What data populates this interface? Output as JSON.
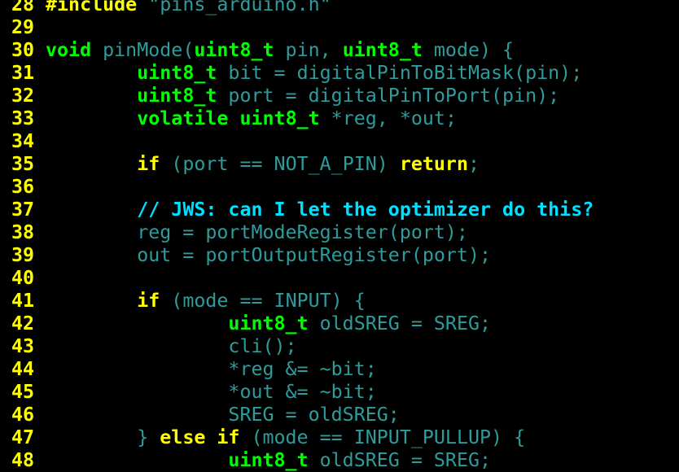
{
  "colors": {
    "background": "#000000",
    "line_number": "#ffff00",
    "type_keyword": "#00ff00",
    "control_keyword": "#ffff00",
    "comment": "#00e0ff",
    "plain_code": "#2e9c9c"
  },
  "lines": [
    {
      "number": "28",
      "tokens": [
        {
          "cls": "kw",
          "text": "#include"
        },
        {
          "cls": "ident",
          "text": " \"pins_arduino.h\""
        }
      ]
    },
    {
      "number": "29",
      "tokens": []
    },
    {
      "number": "30",
      "tokens": [
        {
          "cls": "type",
          "text": "void"
        },
        {
          "cls": "ident",
          "text": " pinMode("
        },
        {
          "cls": "type",
          "text": "uint8_t"
        },
        {
          "cls": "ident",
          "text": " pin, "
        },
        {
          "cls": "type",
          "text": "uint8_t"
        },
        {
          "cls": "ident",
          "text": " mode) {"
        }
      ]
    },
    {
      "number": "31",
      "tokens": [
        {
          "cls": "ident",
          "text": "        "
        },
        {
          "cls": "type",
          "text": "uint8_t"
        },
        {
          "cls": "ident",
          "text": " bit = digitalPinToBitMask(pin);"
        }
      ]
    },
    {
      "number": "32",
      "tokens": [
        {
          "cls": "ident",
          "text": "        "
        },
        {
          "cls": "type",
          "text": "uint8_t"
        },
        {
          "cls": "ident",
          "text": " port = digitalPinToPort(pin);"
        }
      ]
    },
    {
      "number": "33",
      "tokens": [
        {
          "cls": "ident",
          "text": "        "
        },
        {
          "cls": "type",
          "text": "volatile"
        },
        {
          "cls": "ident",
          "text": " "
        },
        {
          "cls": "type",
          "text": "uint8_t"
        },
        {
          "cls": "ident",
          "text": " *reg, *out;"
        }
      ]
    },
    {
      "number": "34",
      "tokens": []
    },
    {
      "number": "35",
      "tokens": [
        {
          "cls": "ident",
          "text": "        "
        },
        {
          "cls": "kw",
          "text": "if"
        },
        {
          "cls": "ident",
          "text": " (port == NOT_A_PIN) "
        },
        {
          "cls": "kw",
          "text": "return"
        },
        {
          "cls": "ident",
          "text": ";"
        }
      ]
    },
    {
      "number": "36",
      "tokens": []
    },
    {
      "number": "37",
      "tokens": [
        {
          "cls": "ident",
          "text": "        "
        },
        {
          "cls": "comment",
          "text": "// JWS: can I let the optimizer do this?"
        }
      ]
    },
    {
      "number": "38",
      "tokens": [
        {
          "cls": "ident",
          "text": "        reg = portModeRegister(port);"
        }
      ]
    },
    {
      "number": "39",
      "tokens": [
        {
          "cls": "ident",
          "text": "        out = portOutputRegister(port);"
        }
      ]
    },
    {
      "number": "40",
      "tokens": []
    },
    {
      "number": "41",
      "tokens": [
        {
          "cls": "ident",
          "text": "        "
        },
        {
          "cls": "kw",
          "text": "if"
        },
        {
          "cls": "ident",
          "text": " (mode == INPUT) {"
        }
      ]
    },
    {
      "number": "42",
      "tokens": [
        {
          "cls": "ident",
          "text": "                "
        },
        {
          "cls": "type",
          "text": "uint8_t"
        },
        {
          "cls": "ident",
          "text": " oldSREG = SREG;"
        }
      ]
    },
    {
      "number": "43",
      "tokens": [
        {
          "cls": "ident",
          "text": "                cli();"
        }
      ]
    },
    {
      "number": "44",
      "tokens": [
        {
          "cls": "ident",
          "text": "                *reg &= ~bit;"
        }
      ]
    },
    {
      "number": "45",
      "tokens": [
        {
          "cls": "ident",
          "text": "                *out &= ~bit;"
        }
      ]
    },
    {
      "number": "46",
      "tokens": [
        {
          "cls": "ident",
          "text": "                SREG = oldSREG;"
        }
      ]
    },
    {
      "number": "47",
      "tokens": [
        {
          "cls": "ident",
          "text": "        } "
        },
        {
          "cls": "kw",
          "text": "else if"
        },
        {
          "cls": "ident",
          "text": " (mode == INPUT_PULLUP) {"
        }
      ]
    },
    {
      "number": "48",
      "tokens": [
        {
          "cls": "ident",
          "text": "                "
        },
        {
          "cls": "type",
          "text": "uint8_t"
        },
        {
          "cls": "ident",
          "text": " oldSREG = SREG;"
        }
      ]
    }
  ]
}
